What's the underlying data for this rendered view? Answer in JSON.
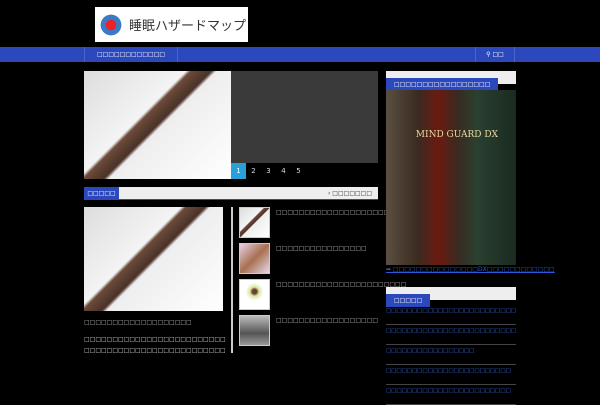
{
  "header": {
    "logo_text": "睡眠ハザードマップ"
  },
  "nav": {
    "item": "□□□□□□□□□□□□",
    "search": "□□"
  },
  "slider": {
    "pages": [
      "1",
      "2",
      "3",
      "4",
      "5"
    ],
    "active": "1"
  },
  "section": {
    "label": "□□□□□",
    "more": "› □□□□□□□"
  },
  "main_post": {
    "title": "□□□□□□□□□□□□□□□□□□□",
    "excerpt": "□□□□□□□□□□□□□□□□□□□□□□□□□□□□□□□□□□□□□□□□□□□□□□□□□□□□□□□□□□□□□□□□□□□□□□□□□□□□□□□□□□□□□□□□□□□□□□□□□□□□□□□□□□□&#8230;"
  },
  "side_posts": [
    {
      "title": "□□□□□□□□□□□□□□□□□□□□□"
    },
    {
      "title": "□□□□□□□□□□□□□□□□"
    },
    {
      "title": "□□□□□□□□□□□□□□□□□□□□□□□"
    },
    {
      "title": "□□□□□□□□□□□□□□□□□□"
    }
  ],
  "sidebar": {
    "widget1_title": "□□□□□□□□□□□□□□□□□",
    "ad_text": "MIND GUARD DX",
    "ad_link": "➡ □□□□□□□□□□□□□□□DX□□□□□□□□□□□□",
    "widget2_title": "□□□□□",
    "recent": [
      "□□□□□□□□□□□□□□□□□□□□□□□□□□□□",
      "□□□□□□□□□□□□□□□□□□□□□□□□□□□□□□□□□□□3□□□□□□□□",
      "□□□□□□□□□□□□□□□□□",
      "□□□□□□□□□□□□□□□□□□□□□□□□",
      "□□□□□□□□□□□□□□□□□□□□□□□□"
    ]
  }
}
